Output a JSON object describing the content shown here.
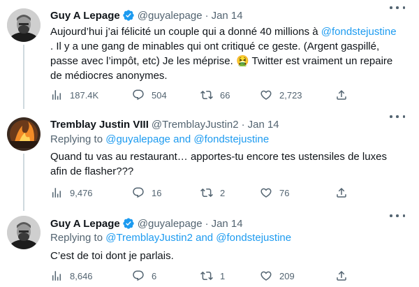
{
  "tweets": [
    {
      "name": "Guy A Lepage",
      "handle": "@guyalepage",
      "dot": "·",
      "date": "Jan 14",
      "text_1": "Aujourd’hui j’ai félicité un couple qui a donné 40 millions à ",
      "mention": "@fondstejustine",
      "text_2": " . Il y a une gang de minables qui ont critiqué ce geste. (Argent gaspillé, passe avec l’impôt, etc) Je les méprise. ",
      "emoji": "🤮",
      "text_3": " Twitter est vraiment un repaire de médiocres anonymes.",
      "views": "187.4K",
      "replies": "504",
      "retweets": "66",
      "likes": "2,723"
    },
    {
      "name": "Tremblay Justin VIII",
      "handle": "@TremblayJustin2",
      "dot": "·",
      "date": "Jan 14",
      "replying_prefix": "Replying to ",
      "replying_to": "@guyalepage and @fondstejustine",
      "text": "Quand tu vas au restaurant… apportes-tu encore tes ustensiles de luxes afin de flasher???",
      "views": "9,476",
      "replies": "16",
      "retweets": "2",
      "likes": "76"
    },
    {
      "name": "Guy A Lepage",
      "handle": "@guyalepage",
      "dot": "·",
      "date": "Jan 14",
      "replying_prefix": "Replying to ",
      "replying_to": "@TremblayJustin2 and @fondstejustine",
      "text": "C’est de toi dont je parlais.",
      "views": "8,646",
      "replies": "6",
      "retweets": "1",
      "likes": "209"
    }
  ],
  "colors": {
    "accent": "#1d9bf0",
    "secondary": "#536471",
    "text": "#0f1419",
    "verified": "#1d9bf0"
  },
  "icons": [
    "views-icon",
    "reply-icon",
    "retweet-icon",
    "like-icon",
    "share-icon",
    "verified-badge-icon",
    "more-icon"
  ]
}
